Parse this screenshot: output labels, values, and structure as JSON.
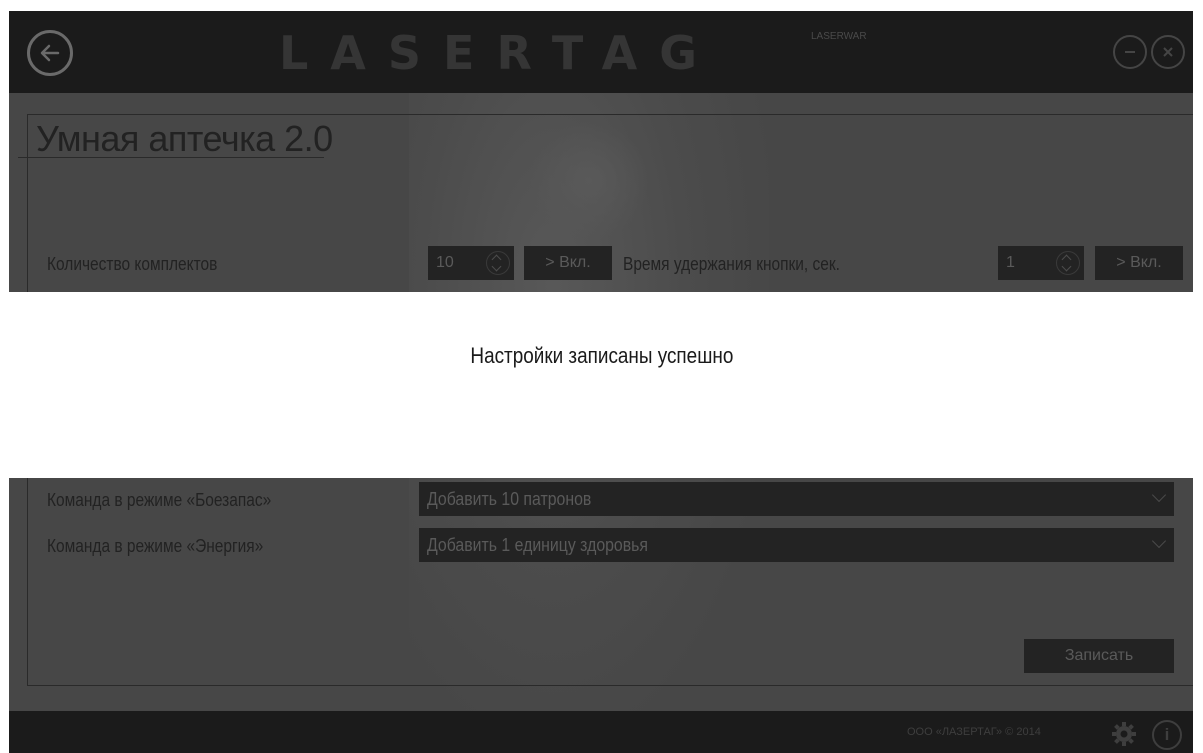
{
  "header": {
    "logo_text": "LASERTAG",
    "logo_sub": "LASERWAR",
    "back_icon": "arrow-left-icon",
    "minimize_icon": "minimize-icon",
    "close_icon": "close-icon"
  },
  "page": {
    "title": "Умная аптечка 2.0"
  },
  "settings": {
    "kits_label": "Количество комплектов",
    "kits_value": "10",
    "kits_toggle": "> Вкл.",
    "hold_label": "Время удержания кнопки, сек.",
    "hold_value": "1",
    "hold_toggle": "> Вкл."
  },
  "commands": {
    "ammo_label": "Команда в режиме «Боезапас»",
    "ammo_value": "Добавить 10 патронов",
    "energy_label": "Команда в режиме «Энергия»",
    "energy_value": "Добавить 1 единицу здоровья"
  },
  "actions": {
    "save_label": "Записать"
  },
  "footer": {
    "copyright": "ООО «ЛАЗЕРТАГ» © 2014",
    "settings_icon": "gear-icon",
    "info_icon": "info-icon"
  },
  "toast": {
    "message": "Настройки записаны успешно"
  },
  "colors": {
    "header_bg": "#1b1b1b",
    "body_bg": "#474747",
    "control_bg": "#232323",
    "toast_bg": "#ffffff"
  }
}
